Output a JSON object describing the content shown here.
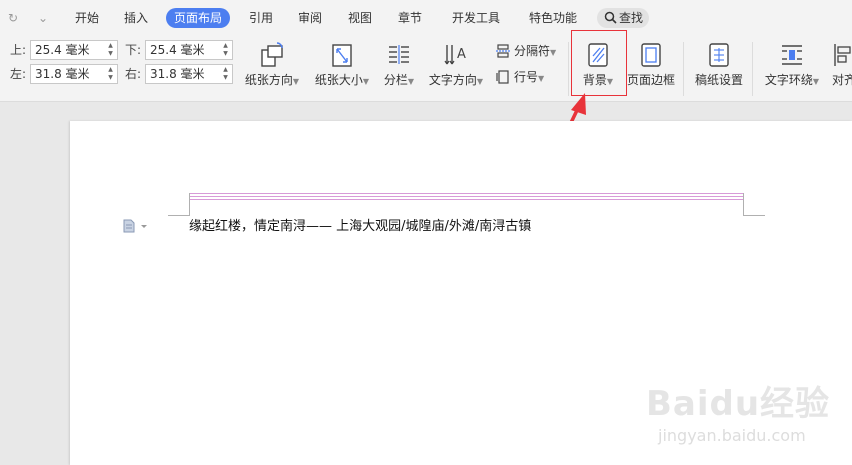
{
  "menubar": {
    "quick_access": {
      "redo": "↻",
      "dropdown": "⌄"
    },
    "tabs": [
      "开始",
      "插入",
      "页面布局",
      "引用",
      "审阅",
      "视图",
      "章节",
      "开发工具",
      "特色功能"
    ],
    "active_tab": "页面布局",
    "search_label": "查找",
    "accent_color": "#4c7ef0"
  },
  "margins": {
    "top": {
      "label": "上:",
      "value": "25.4 毫米"
    },
    "bottom": {
      "label": "下:",
      "value": "25.4 毫米"
    },
    "left": {
      "label": "左:",
      "value": "31.8 毫米"
    },
    "right": {
      "label": "右:",
      "value": "31.8 毫米"
    }
  },
  "ribbon": {
    "orientation": "纸张方向",
    "size": "纸张大小",
    "columns": "分栏",
    "text_direction": "文字方向",
    "breaks": "分隔符",
    "line_numbers": "行号",
    "background": "背景",
    "page_border": "页面边框",
    "manuscript": "稿纸设置",
    "text_wrap": "文字环绕",
    "align": "对齐"
  },
  "document": {
    "line1": "缘起红楼，情定南浔——  上海大观园/城隍庙/外滩/南浔古镇"
  },
  "watermark": {
    "logo": "Baidu经验",
    "url": "jingyan.baidu.com"
  },
  "highlight_color": "#e8333a"
}
